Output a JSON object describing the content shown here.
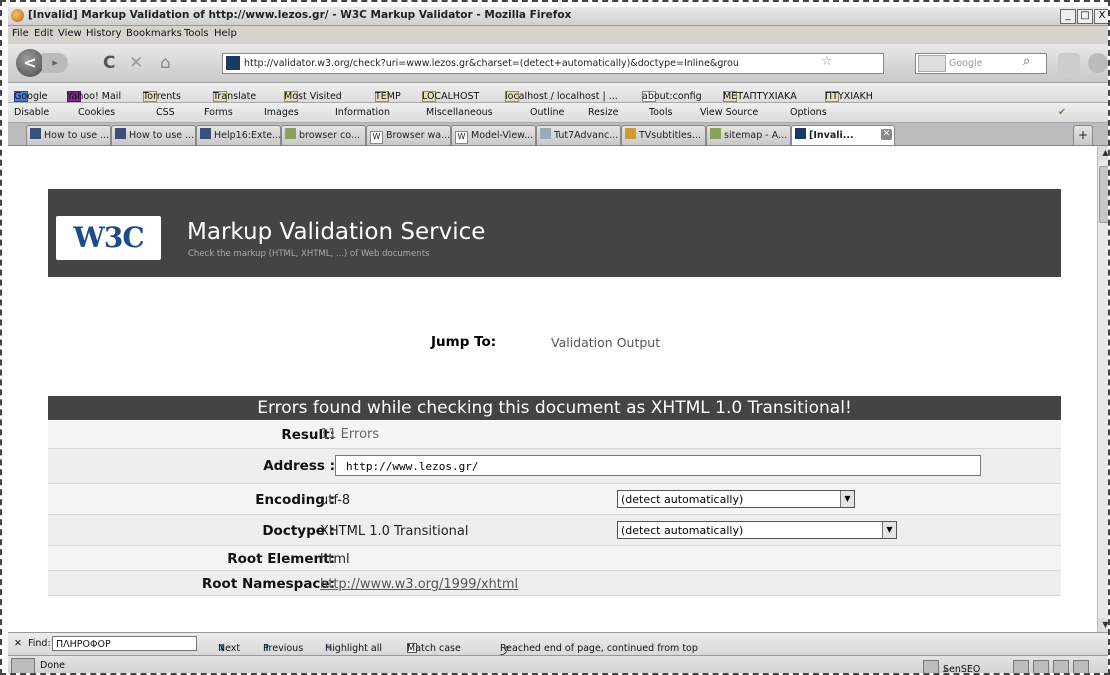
{
  "window": {
    "title": "[Invalid] Markup Validation of http://www.lezos.gr/ - W3C Markup Validator - Mozilla Firefox",
    "controls": [
      "_",
      "□",
      "X"
    ]
  },
  "menu": [
    "File",
    "Edit",
    "View",
    "History",
    "Bookmarks",
    "Tools",
    "Help"
  ],
  "nav": {
    "url": "http://validator.w3.org/check?uri=www.lezos.gr&charset=(detect+automatically)&doctype=Inline&grou",
    "search_placeholder": "Google",
    "back_glyph": "<",
    "forward_glyph": "▸",
    "reload_glyph": "C",
    "stop_glyph": "✕",
    "home_glyph": "⌂",
    "star_glyph": "☆",
    "search_glyph": "⌕"
  },
  "bookmarks": [
    "Google",
    "Yahoo! Mail",
    "Torrents",
    "Translate",
    "Most Visited",
    "TEMP",
    "LOCALHOST",
    "localhost / localhost | ...",
    "about:config",
    "ΜΕΤΑΠΤΥΧΙΑΚΑ",
    "ΠΤΥΧΙΑΚΗ"
  ],
  "webdev_toolbar": [
    "Disable",
    "Cookies",
    "CSS",
    "Forms",
    "Images",
    "Information",
    "Miscellaneous",
    "Outline",
    "Resize",
    "Tools",
    "View Source",
    "Options"
  ],
  "tabs": [
    {
      "label": "How to use ..."
    },
    {
      "label": "How to use ..."
    },
    {
      "label": "Help16:Exte..."
    },
    {
      "label": "browser co..."
    },
    {
      "label": "Browser wa..."
    },
    {
      "label": "Model-View..."
    },
    {
      "label": "Tut7Advanc..."
    },
    {
      "label": "TVsubtitles..."
    },
    {
      "label": "sitemap - A..."
    },
    {
      "label": "[Invali..."
    }
  ],
  "page": {
    "logo": "W3C",
    "title": "Markup Validation Service",
    "subtitle": "Check the markup (HTML, XHTML, ...) of Web documents",
    "jump_label": "Jump To:",
    "jump_link": "Validation Output",
    "error_header": "Errors found while checking this document as XHTML 1.0 Transitional!",
    "rows": [
      {
        "label": "Result:",
        "value": "11 Errors"
      },
      {
        "label": "Address :",
        "value": "http://www.lezos.gr/"
      },
      {
        "label": "Encoding :",
        "value": "utf-8",
        "select": "(detect automatically)"
      },
      {
        "label": "Doctype :",
        "value": "XHTML 1.0 Transitional",
        "select": "(detect automatically)"
      },
      {
        "label": "Root Element:",
        "value": "html"
      },
      {
        "label": "Root Namespace:",
        "value": "http://www.w3.org/1999/xhtml"
      }
    ]
  },
  "findbar": {
    "label": "Find:",
    "value": "ΠΛΗΡΟΦΟΡ",
    "next": "Next",
    "previous": "Previous",
    "highlight": "Highlight all",
    "matchcase": "Match case",
    "status": "Reached end of page, continued from top"
  },
  "statusbar": {
    "text": "Done",
    "seo": "SenSEO"
  }
}
